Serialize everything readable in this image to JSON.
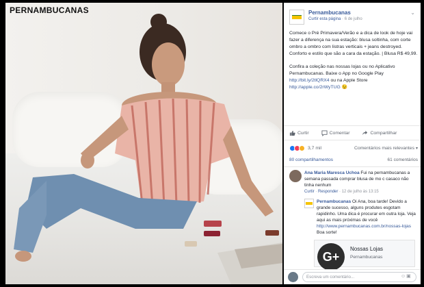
{
  "photo": {
    "watermark": "PERNAMBUCANAS"
  },
  "post": {
    "page_name": "Pernambucanas",
    "meta_link": "Curtir esta página",
    "date": "6 de julho",
    "paragraph1": "Comece o Pré Primavera/Verão e a dica de look de hoje vai fazer a diferença na sua estação: blusa soltinha, com corte ombro a ombro com listras verticais + jeans destroyed. Conforto e estilo que são a cara da estação. | Blusa R$ 49,99.",
    "paragraph2_text": "Confira a coleção nas nossas lojas ou no Aplicativo Pernambucanas. Baixe o App no Google Play",
    "link1": "http://bit.ly/2tlQRX4",
    "paragraph2_mid": "ou na Apple Store",
    "link2": "http://apple.co/2rWyTUG",
    "emoji": "😉"
  },
  "actions": {
    "like": "Curtir",
    "comment": "Comentar",
    "share": "Compartilhar"
  },
  "reactions": {
    "count": "3,7 mil",
    "relevance": "Comentários mais relevantes",
    "shares": "80 compartilhamentos",
    "comments_count": "61 comentários"
  },
  "comments": [
    {
      "name": "Ana Maria Maresca Uchoa",
      "text": "Fui na pernambucanas a semana passada comprar blusa de mo c casaco não tinha nenhum",
      "like": "Curtir",
      "reply": "Responder",
      "time": "12 de julho às 13:15"
    },
    {
      "name": "Pernambucanas",
      "text": "Oi Ana, boa tarde! Devido a grande sucesso, alguns produtes esgotam rapidinho. Uma dica é procurar em outra loja. Veja aqui as mais próximas de você",
      "link": "http://www.pernambucanas.com.br/nossas-lojas",
      "tail": "Boa sorte!"
    }
  ],
  "card": {
    "title": "Nossas Lojas",
    "subtitle": "Pernambucanas",
    "icon": "G+"
  },
  "compose": {
    "placeholder": "Escreva um comentário..."
  },
  "colors": {
    "link": "#365899",
    "text": "#1d2129",
    "muted": "#90949c"
  }
}
